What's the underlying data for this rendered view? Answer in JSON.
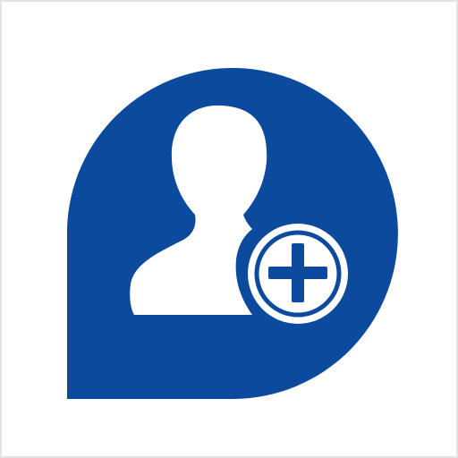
{
  "icon": {
    "name": "add-contact-icon",
    "colors": {
      "background": "#ffffff",
      "frame": "#e4e4e4",
      "bubble": "#0b4a9c",
      "silhouette": "#ffffff",
      "plus_badge_fill": "#ffffff",
      "plus_badge_ring": "#0b4a9c",
      "plus_sign": "#0b4a9c"
    },
    "parts": [
      "speech-bubble",
      "person-silhouette",
      "plus-badge"
    ]
  }
}
